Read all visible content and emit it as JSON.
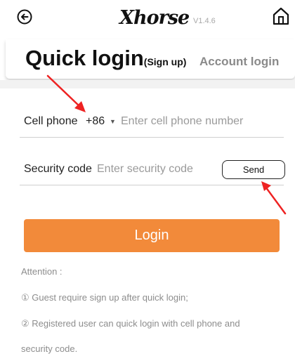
{
  "header": {
    "brand": "Xhorse",
    "version": "V1.4.6",
    "back_icon": "back-circle-arrow-icon",
    "home_icon": "home-icon"
  },
  "tabs": {
    "quick_login": "Quick login",
    "quick_login_sub": "(Sign up)",
    "account_login": "Account login"
  },
  "form": {
    "phone_label": "Cell phone",
    "country_code": "+86",
    "phone_placeholder": "Enter cell phone number",
    "code_label": "Security code",
    "code_placeholder": "Enter security code",
    "send_label": "Send",
    "login_label": "Login"
  },
  "notes": {
    "title": "Attention :",
    "item1": "① Guest require sign up after quick login;",
    "item2": "② Registered user can quick login with cell phone and",
    "item2_cont": "security code."
  },
  "colors": {
    "accent": "#f28a3a",
    "annotation_arrow": "#ee2222"
  }
}
